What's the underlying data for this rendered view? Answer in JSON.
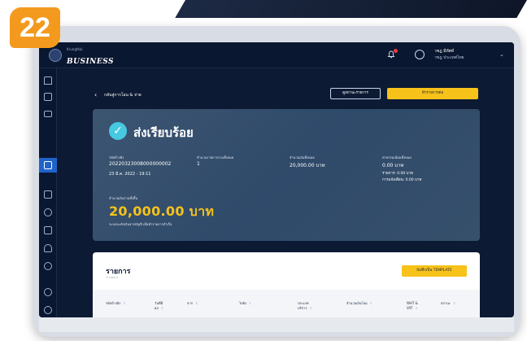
{
  "step_badge": "22",
  "header": {
    "logo_small": "Krungthai",
    "logo_big": "BUSINESS",
    "user_name": "วชฎ มีทัศท์",
    "user_sub": "วชฎ ประเทศไทย"
  },
  "sidebar": {
    "icons": [
      "home-icon",
      "document-icon",
      "card-icon",
      "transfer-icon",
      "bill-icon",
      "settings-icon",
      "report-icon",
      "users-icon",
      "history-icon",
      "gear-icon",
      "logout-icon"
    ]
  },
  "page": {
    "back_label": "กลับสู่การโอน & จ่าย",
    "view_items_button": "ดูสถานะรายการ",
    "next_button": "ทำรายการต่อ"
  },
  "success": {
    "title": "ส่งเรียบร้อย",
    "ref_label": "รหัสอ้างอิง",
    "ref_value": "20220323008000000002",
    "date_value": "23 มี.ค. 2022 - 19:11",
    "count_label": "จำนวนรายการรวมทั้งหมด",
    "count_value": "1",
    "amount_label": "จำนวนเงินทั้งหมด",
    "amount_value": "20,000.00 บาท",
    "fee_label": "ค่าธรรมเนียมทั้งหมด",
    "fee_value": "0.00 บาท",
    "fee_line1": "รายการ: 0.00 บาท",
    "fee_line2": "การแจ้งเตือน: 0.00 บาท",
    "total_label": "จำนวนเงินรวมทั้งสิ้น",
    "total_value": "20,000.00 บาท",
    "total_note": "ระบบจะหักเงินจากบัญชี เมื่อทำรายการสำเร็จ"
  },
  "list": {
    "title": "รายการ",
    "subtitle": "1 รายการ",
    "template_button": "บันทึกเป็น TEMPLATE",
    "columns": [
      "รหัสอ้างอิง",
      "วันที่มี ผล",
      "จาก",
      "ไปยัง",
      "ประเภท บริการ",
      "จำนวนเงินโอน",
      "WHT & VAT",
      "สถานะ"
    ]
  },
  "colors": {
    "accent_yellow": "#f7c21a",
    "navy": "#0c1a33",
    "badge_orange": "#f39a1e",
    "success_teal": "#46c8e0"
  }
}
